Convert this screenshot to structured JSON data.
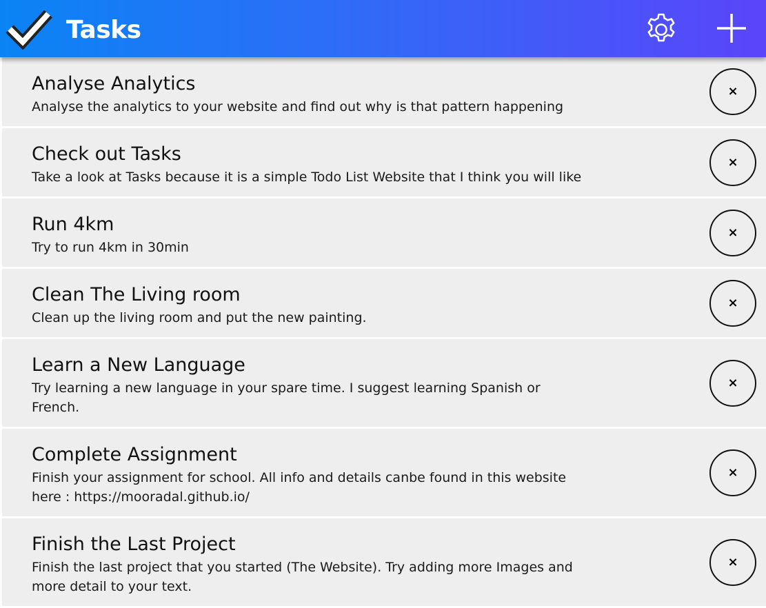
{
  "app": {
    "title": "Tasks",
    "logo_icon": "checkmark-icon"
  },
  "header": {
    "settings_icon": "gear-icon",
    "add_icon": "plus-icon"
  },
  "colors": {
    "header_gradient_start": "#0a84f5",
    "header_gradient_end": "#5a45fa",
    "task_background": "#eeeeee"
  },
  "tasks": [
    {
      "title": "Analyse Analytics",
      "description": "Analyse the analytics to your website and find out why is that pattern happening",
      "delete_label": "×"
    },
    {
      "title": "Check out Tasks",
      "description": "Take a look at Tasks because it is a simple Todo List Website that I think you will like",
      "delete_label": "×"
    },
    {
      "title": "Run 4km",
      "description": "Try to run 4km in 30min",
      "delete_label": "×"
    },
    {
      "title": "Clean The Living room",
      "description": "Clean up the living room and put the new painting.",
      "delete_label": "×"
    },
    {
      "title": "Learn a New Language",
      "description": "Try learning a new language in your spare time. I suggest learning Spanish or French.",
      "delete_label": "×"
    },
    {
      "title": "Complete Assignment",
      "description": "Finish your assignment for school. All info and details canbe found in this website here : https://mooradal.github.io/",
      "delete_label": "×"
    },
    {
      "title": "Finish the Last Project",
      "description": "Finish the last project that you started (The Website). Try adding more Images and more detail to your text.",
      "delete_label": "×"
    }
  ]
}
